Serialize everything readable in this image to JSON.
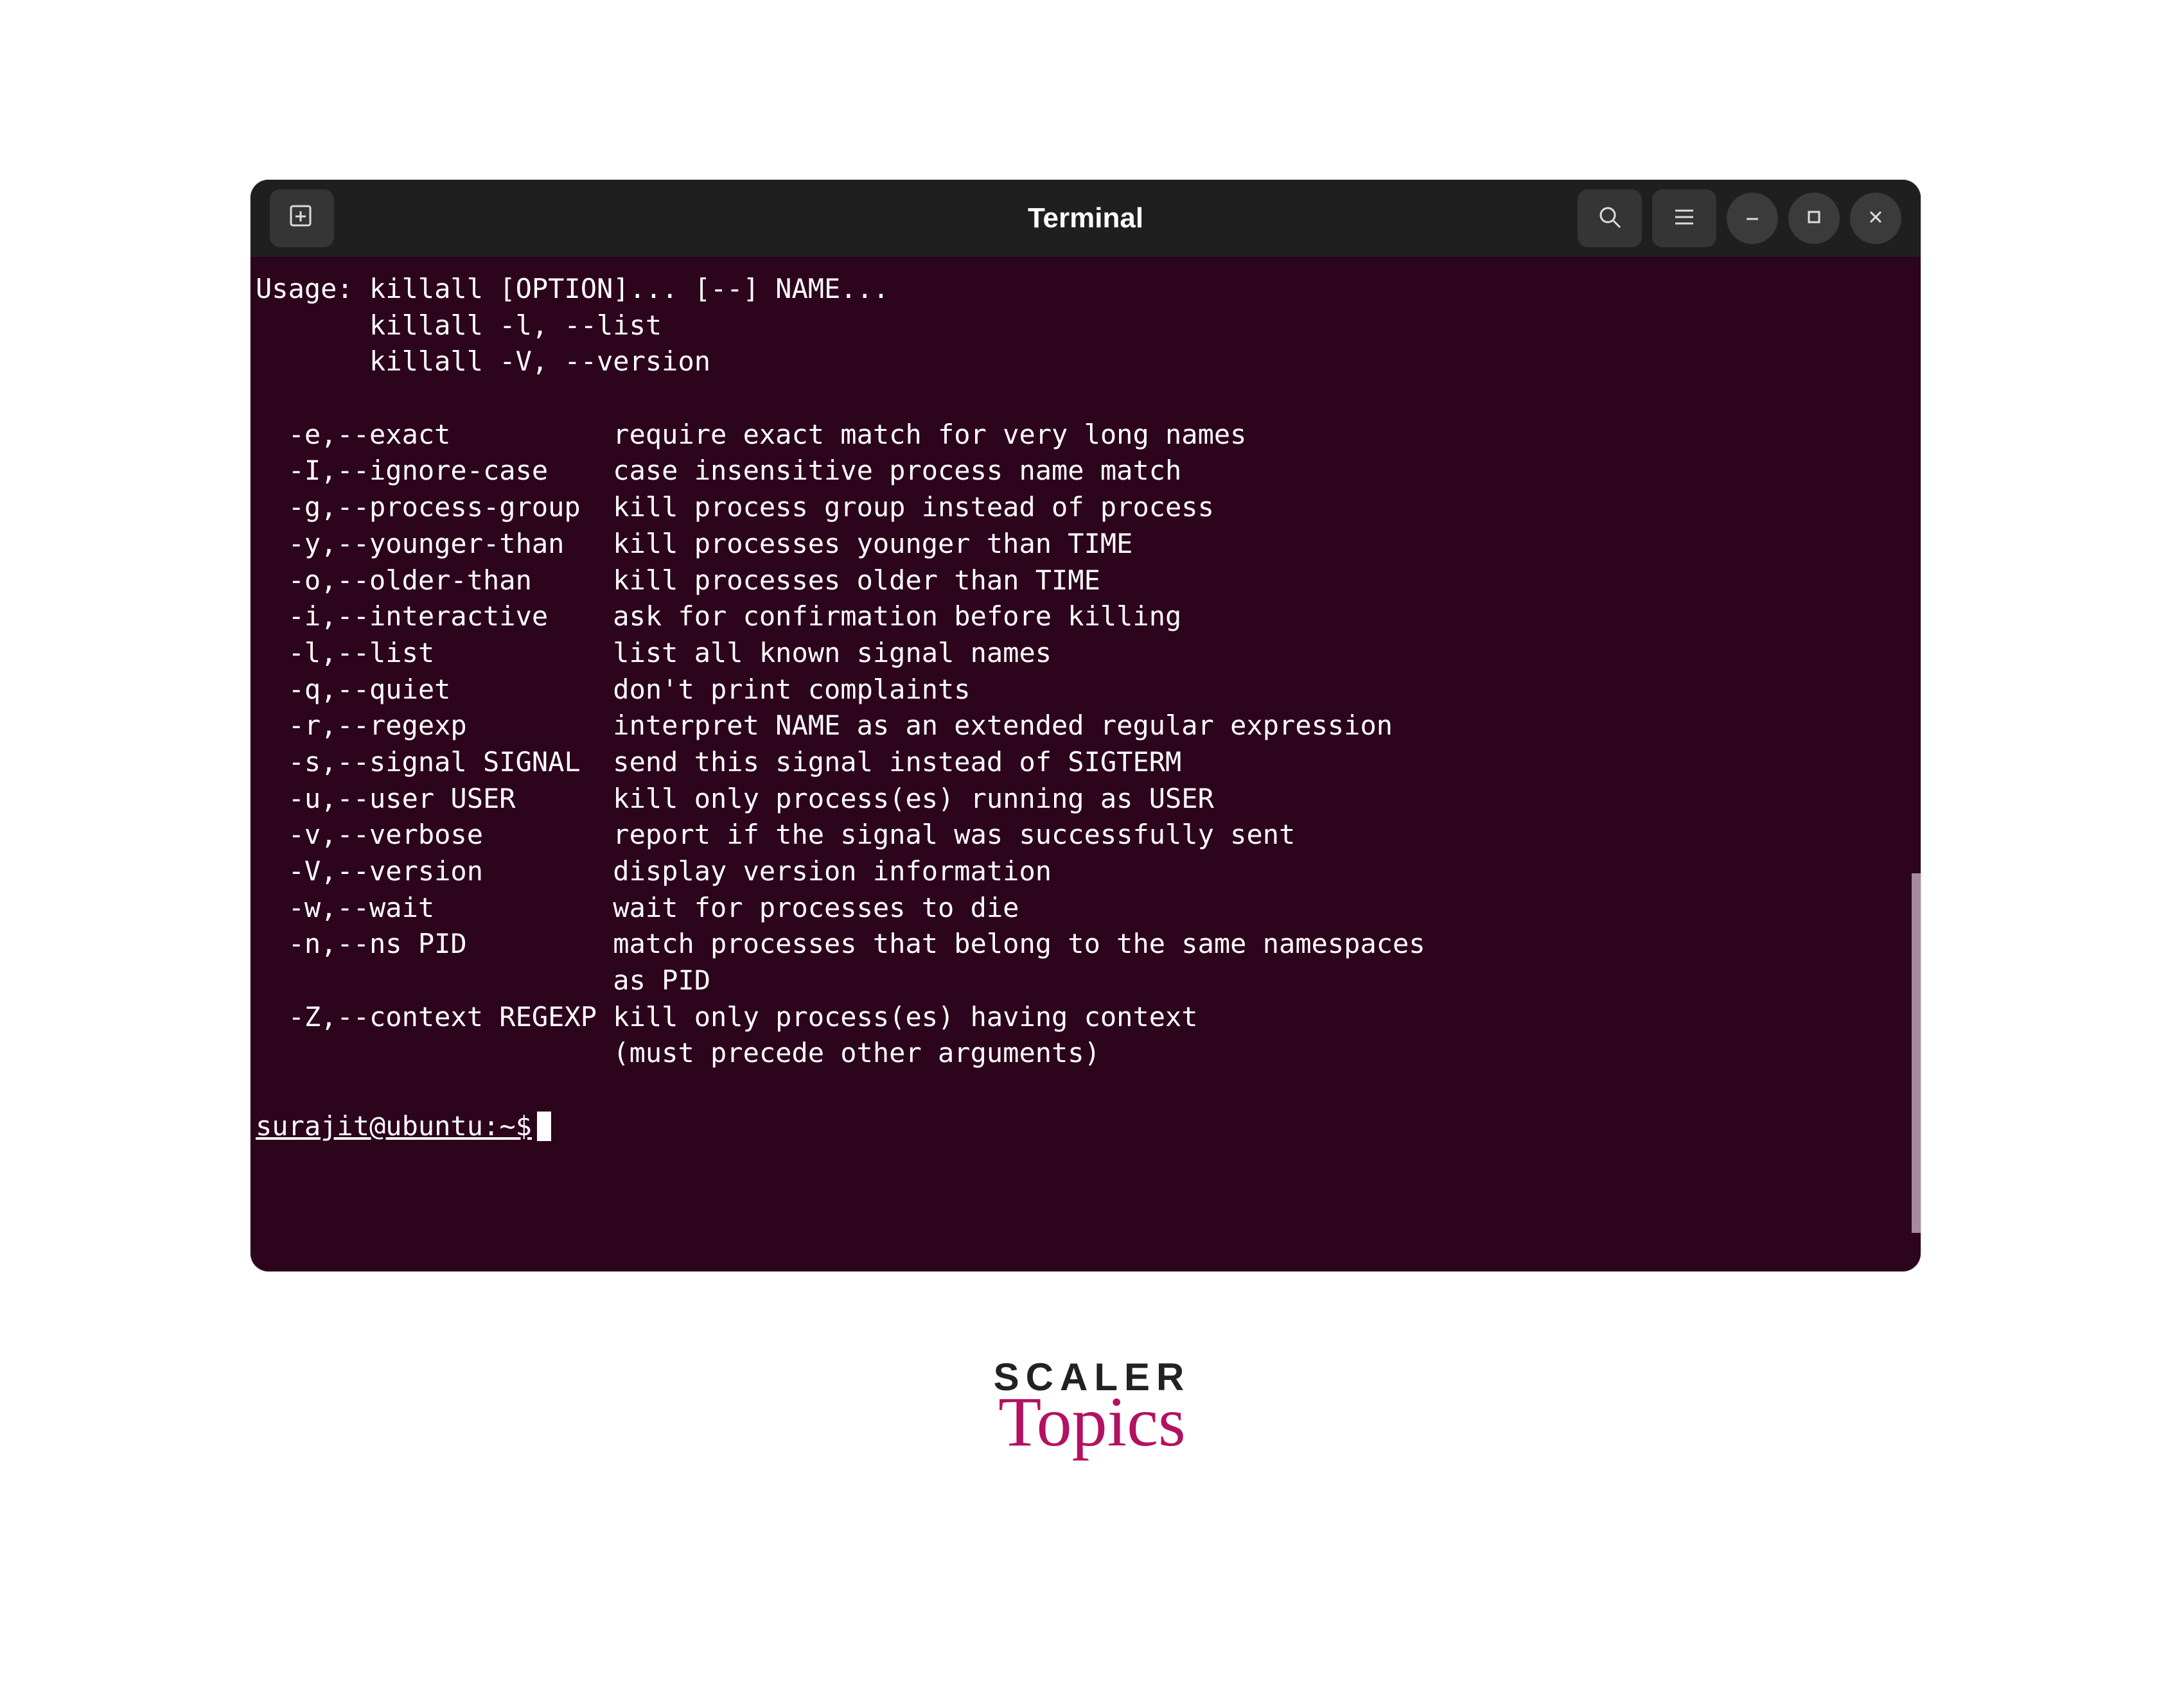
{
  "window": {
    "title": "Terminal"
  },
  "usage": {
    "line1": "Usage: killall [OPTION]... [--] NAME...",
    "line2": "       killall -l, --list",
    "line3": "       killall -V, --version"
  },
  "options": [
    {
      "flag": "  -e,--exact          ",
      "desc": "require exact match for very long names"
    },
    {
      "flag": "  -I,--ignore-case    ",
      "desc": "case insensitive process name match"
    },
    {
      "flag": "  -g,--process-group  ",
      "desc": "kill process group instead of process"
    },
    {
      "flag": "  -y,--younger-than   ",
      "desc": "kill processes younger than TIME"
    },
    {
      "flag": "  -o,--older-than     ",
      "desc": "kill processes older than TIME"
    },
    {
      "flag": "  -i,--interactive    ",
      "desc": "ask for confirmation before killing"
    },
    {
      "flag": "  -l,--list           ",
      "desc": "list all known signal names"
    },
    {
      "flag": "  -q,--quiet          ",
      "desc": "don't print complaints"
    },
    {
      "flag": "  -r,--regexp         ",
      "desc": "interpret NAME as an extended regular expression"
    },
    {
      "flag": "  -s,--signal SIGNAL  ",
      "desc": "send this signal instead of SIGTERM"
    },
    {
      "flag": "  -u,--user USER      ",
      "desc": "kill only process(es) running as USER"
    },
    {
      "flag": "  -v,--verbose        ",
      "desc": "report if the signal was successfully sent"
    },
    {
      "flag": "  -V,--version        ",
      "desc": "display version information"
    },
    {
      "flag": "  -w,--wait           ",
      "desc": "wait for processes to die"
    },
    {
      "flag": "  -n,--ns PID         ",
      "desc": "match processes that belong to the same namespaces"
    },
    {
      "flag": "                      ",
      "desc": "as PID"
    },
    {
      "flag": "  -Z,--context REGEXP ",
      "desc": "kill only process(es) having context"
    },
    {
      "flag": "                      ",
      "desc": "(must precede other arguments)"
    }
  ],
  "prompt": {
    "user": "surajit@ubuntu",
    "sep": ":",
    "path": "~",
    "sign": "$"
  },
  "logo": {
    "line1": "SCALER",
    "line2": "Topics"
  }
}
